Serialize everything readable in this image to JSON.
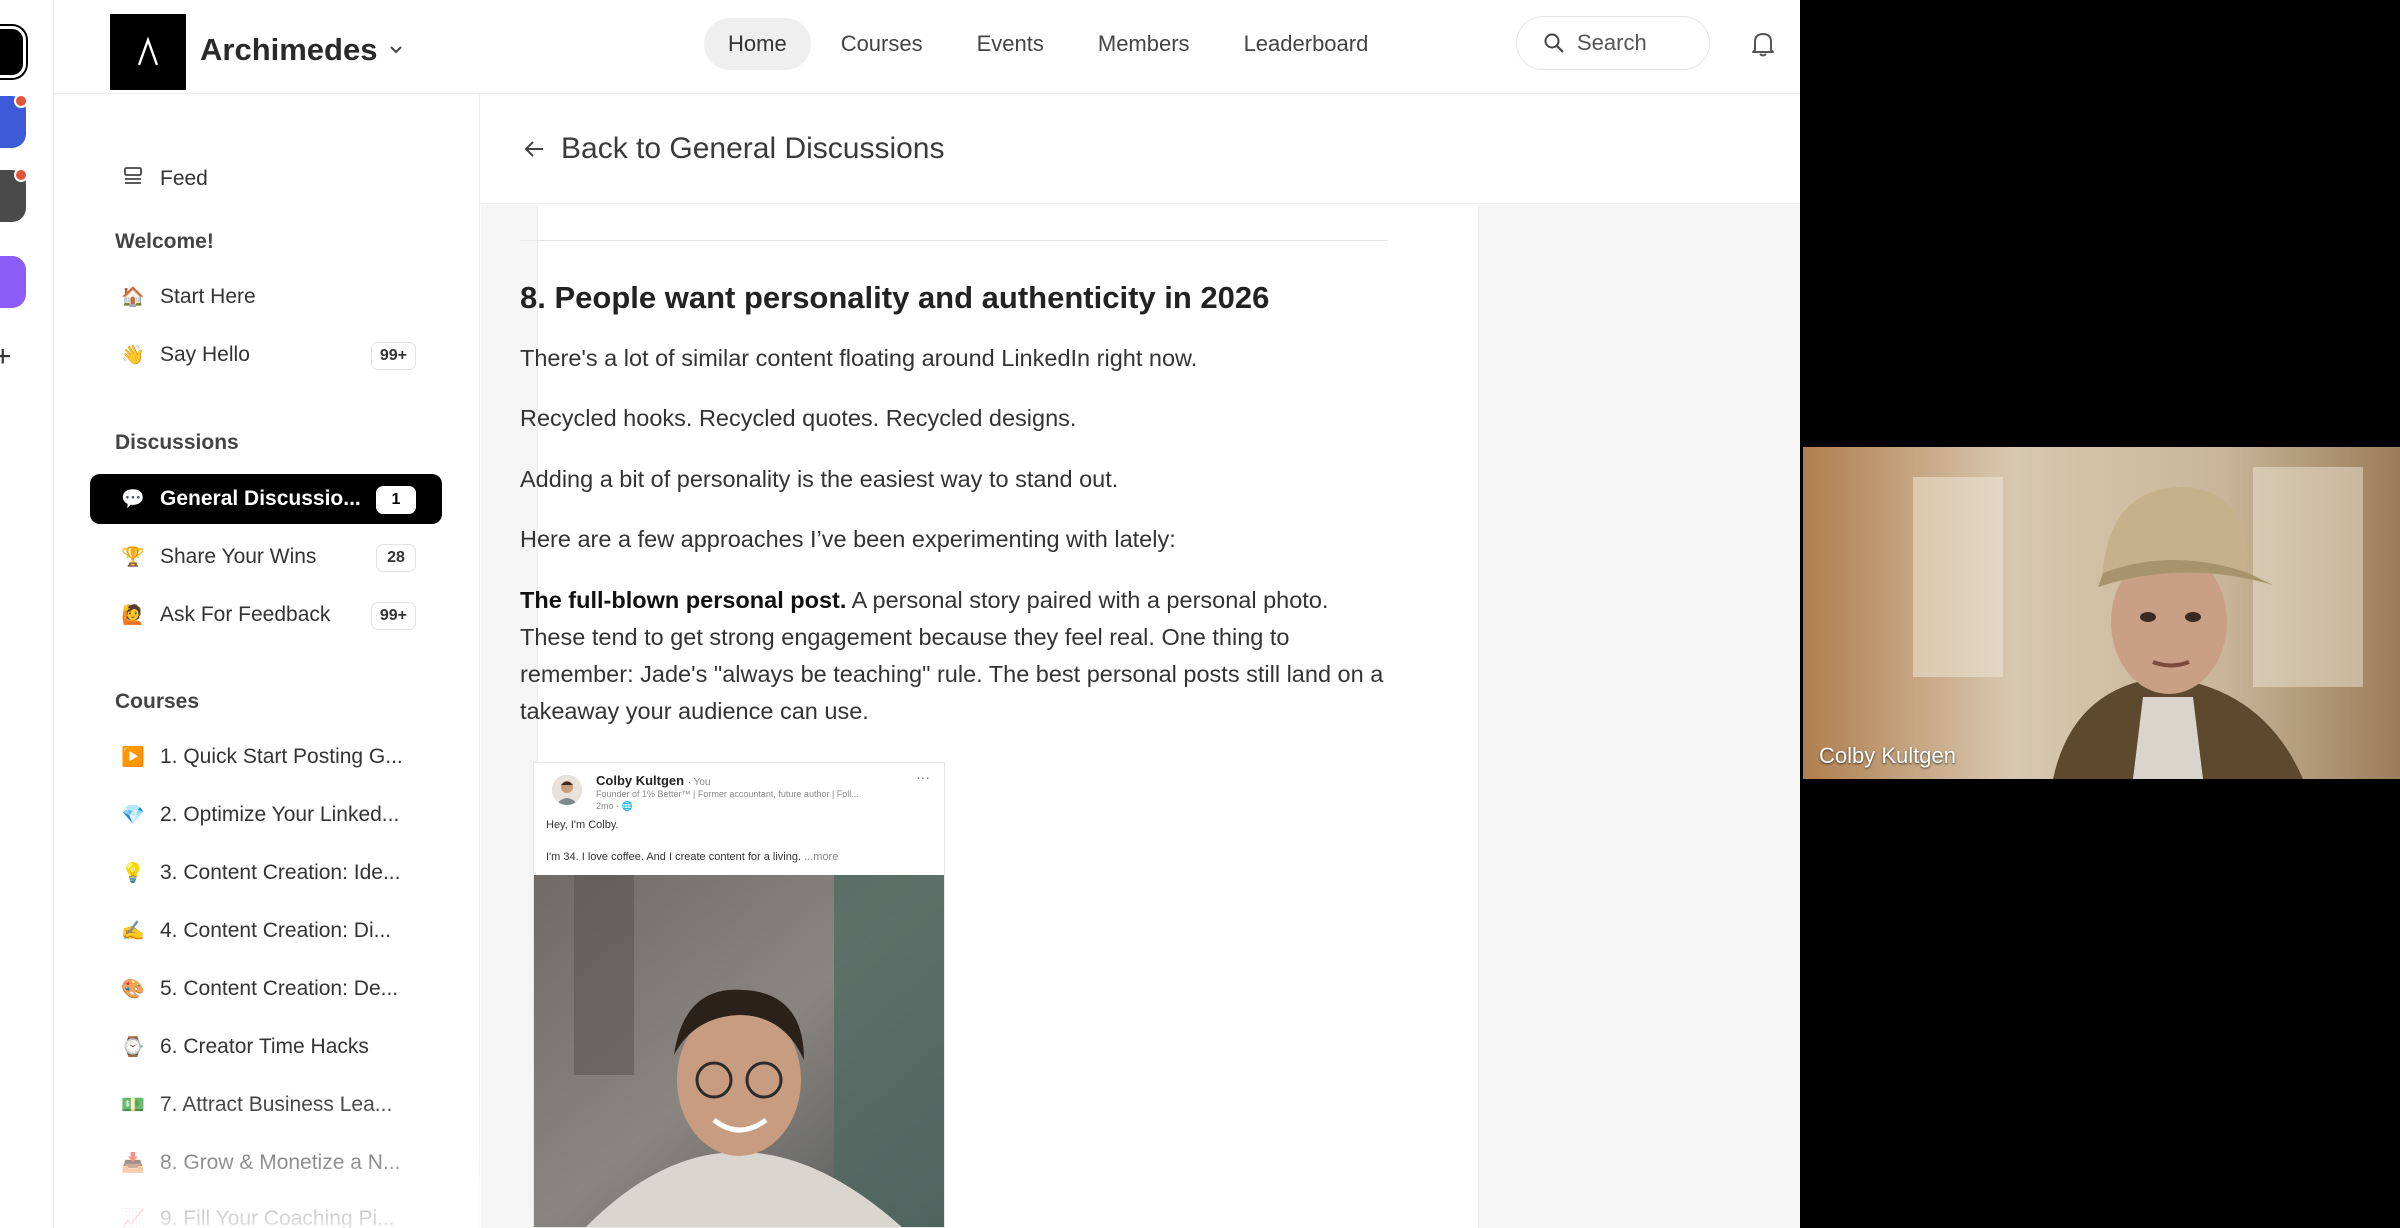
{
  "header": {
    "community_name": "Archimedes",
    "nav": [
      "Home",
      "Courses",
      "Events",
      "Members",
      "Leaderboard"
    ],
    "search_label": "Search"
  },
  "sidebar": {
    "feed_label": "Feed",
    "welcome": {
      "heading": "Welcome!",
      "items": [
        {
          "emoji": "🏠",
          "label": "Start Here",
          "badge": ""
        },
        {
          "emoji": "👋",
          "label": "Say Hello",
          "badge": "99+"
        }
      ]
    },
    "discussions": {
      "heading": "Discussions",
      "items": [
        {
          "emoji": "💬",
          "label": "General Discussio...",
          "badge": "1",
          "active": true
        },
        {
          "emoji": "🏆",
          "label": "Share Your Wins",
          "badge": "28"
        },
        {
          "emoji": "🙋",
          "label": "Ask For Feedback",
          "badge": "99+"
        }
      ]
    },
    "courses": {
      "heading": "Courses",
      "items": [
        {
          "emoji": "▶️",
          "label": "1. Quick Start Posting G..."
        },
        {
          "emoji": "💎",
          "label": "2. Optimize Your Linked..."
        },
        {
          "emoji": "💡",
          "label": "3. Content Creation: Ide..."
        },
        {
          "emoji": "✍️",
          "label": "4. Content Creation: Di..."
        },
        {
          "emoji": "🎨",
          "label": "5. Content Creation: De..."
        },
        {
          "emoji": "⌚",
          "label": "6. Creator Time Hacks"
        },
        {
          "emoji": "💵",
          "label": "7. Attract Business Lea..."
        },
        {
          "emoji": "📥",
          "label": "8. Grow & Monetize a N..."
        },
        {
          "emoji": "📈",
          "label": "9. Fill Your Coaching Pi..."
        }
      ]
    }
  },
  "content": {
    "back_label": "Back to General Discussions",
    "heading": "8. People want personality and authenticity in 2026",
    "paragraphs": [
      "There's a lot of similar content floating around LinkedIn right now.",
      "Recycled hooks. Recycled quotes. Recycled designs.",
      "Adding a bit of personality is the easiest way to stand out.",
      "Here are a few approaches I’ve been experimenting with lately:"
    ],
    "bold_lead": "The full-blown personal post.",
    "bold_para_rest": " A personal story paired with a personal photo. These tend to get strong engagement because they feel real. One thing to remember: Jade's \"always be teaching\" rule. The best personal posts still land on a takeaway your audience can use."
  },
  "linkedin_embed": {
    "name": "Colby Kultgen",
    "you_tag": "· You",
    "headline": "Founder of 1% Better™ | Former accountant, future author | Foll...",
    "time": "2mo · 🌐",
    "line1": "Hey, I'm Colby.",
    "line2": "I'm 34. I love coffee. And I create content for a living.",
    "more": "...more"
  },
  "video": {
    "participant_name": "Colby Kultgen"
  },
  "colors": {
    "active_item_bg": "#000000",
    "content_bg": "#f5f5f5",
    "notification_dot": "#e0533d"
  }
}
